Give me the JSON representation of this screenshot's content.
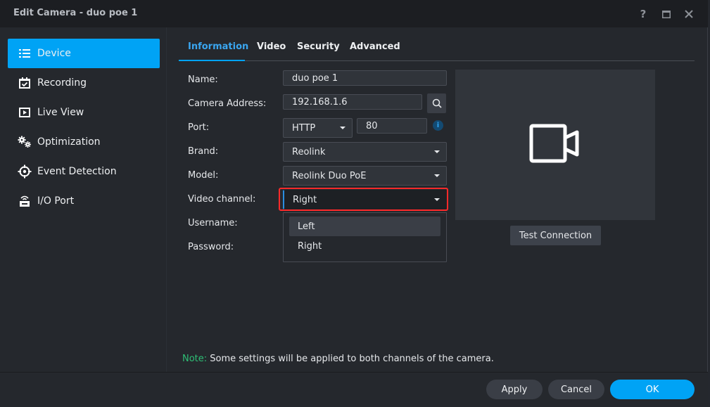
{
  "window": {
    "title": "Edit Camera - duo poe 1",
    "help_label": "?",
    "maximize_icon": "maximize-icon",
    "close_icon": "close-icon"
  },
  "sidebar": {
    "items": [
      {
        "label": "Device",
        "icon": "list-icon",
        "active": true
      },
      {
        "label": "Recording",
        "icon": "calendar-check-icon",
        "active": false
      },
      {
        "label": "Live View",
        "icon": "play-square-icon",
        "active": false
      },
      {
        "label": "Optimization",
        "icon": "gears-icon",
        "active": false
      },
      {
        "label": "Event Detection",
        "icon": "crosshair-icon",
        "active": false
      },
      {
        "label": "I/O Port",
        "icon": "io-port-icon",
        "active": false
      }
    ]
  },
  "tabs": [
    {
      "label": "Information",
      "active": true
    },
    {
      "label": "Video",
      "active": false
    },
    {
      "label": "Security",
      "active": false
    },
    {
      "label": "Advanced",
      "active": false
    }
  ],
  "form": {
    "name": {
      "label": "Name:",
      "value": "duo poe 1"
    },
    "camera_address": {
      "label": "Camera Address:",
      "value": "192.168.1.6"
    },
    "port": {
      "label": "Port:",
      "protocol": "HTTP",
      "value": "80",
      "info_glyph": "i"
    },
    "brand": {
      "label": "Brand:",
      "value": "Reolink"
    },
    "model": {
      "label": "Model:",
      "value": "Reolink Duo PoE"
    },
    "video_channel": {
      "label": "Video channel:",
      "value": "Right",
      "options": [
        "Left",
        "Right"
      ],
      "hovered_option": "Left"
    },
    "username": {
      "label": "Username:"
    },
    "password": {
      "label": "Password:"
    }
  },
  "preview": {
    "icon": "video-camera-icon",
    "test_button": "Test Connection"
  },
  "note": {
    "label": "Note:",
    "text": " Some settings will be applied to both channels of the camera."
  },
  "footer": {
    "apply": "Apply",
    "cancel": "Cancel",
    "ok": "OK"
  },
  "colors": {
    "accent": "#00a3f5",
    "note_green": "#2ebf76",
    "highlight_red": "#ff2a2a"
  }
}
